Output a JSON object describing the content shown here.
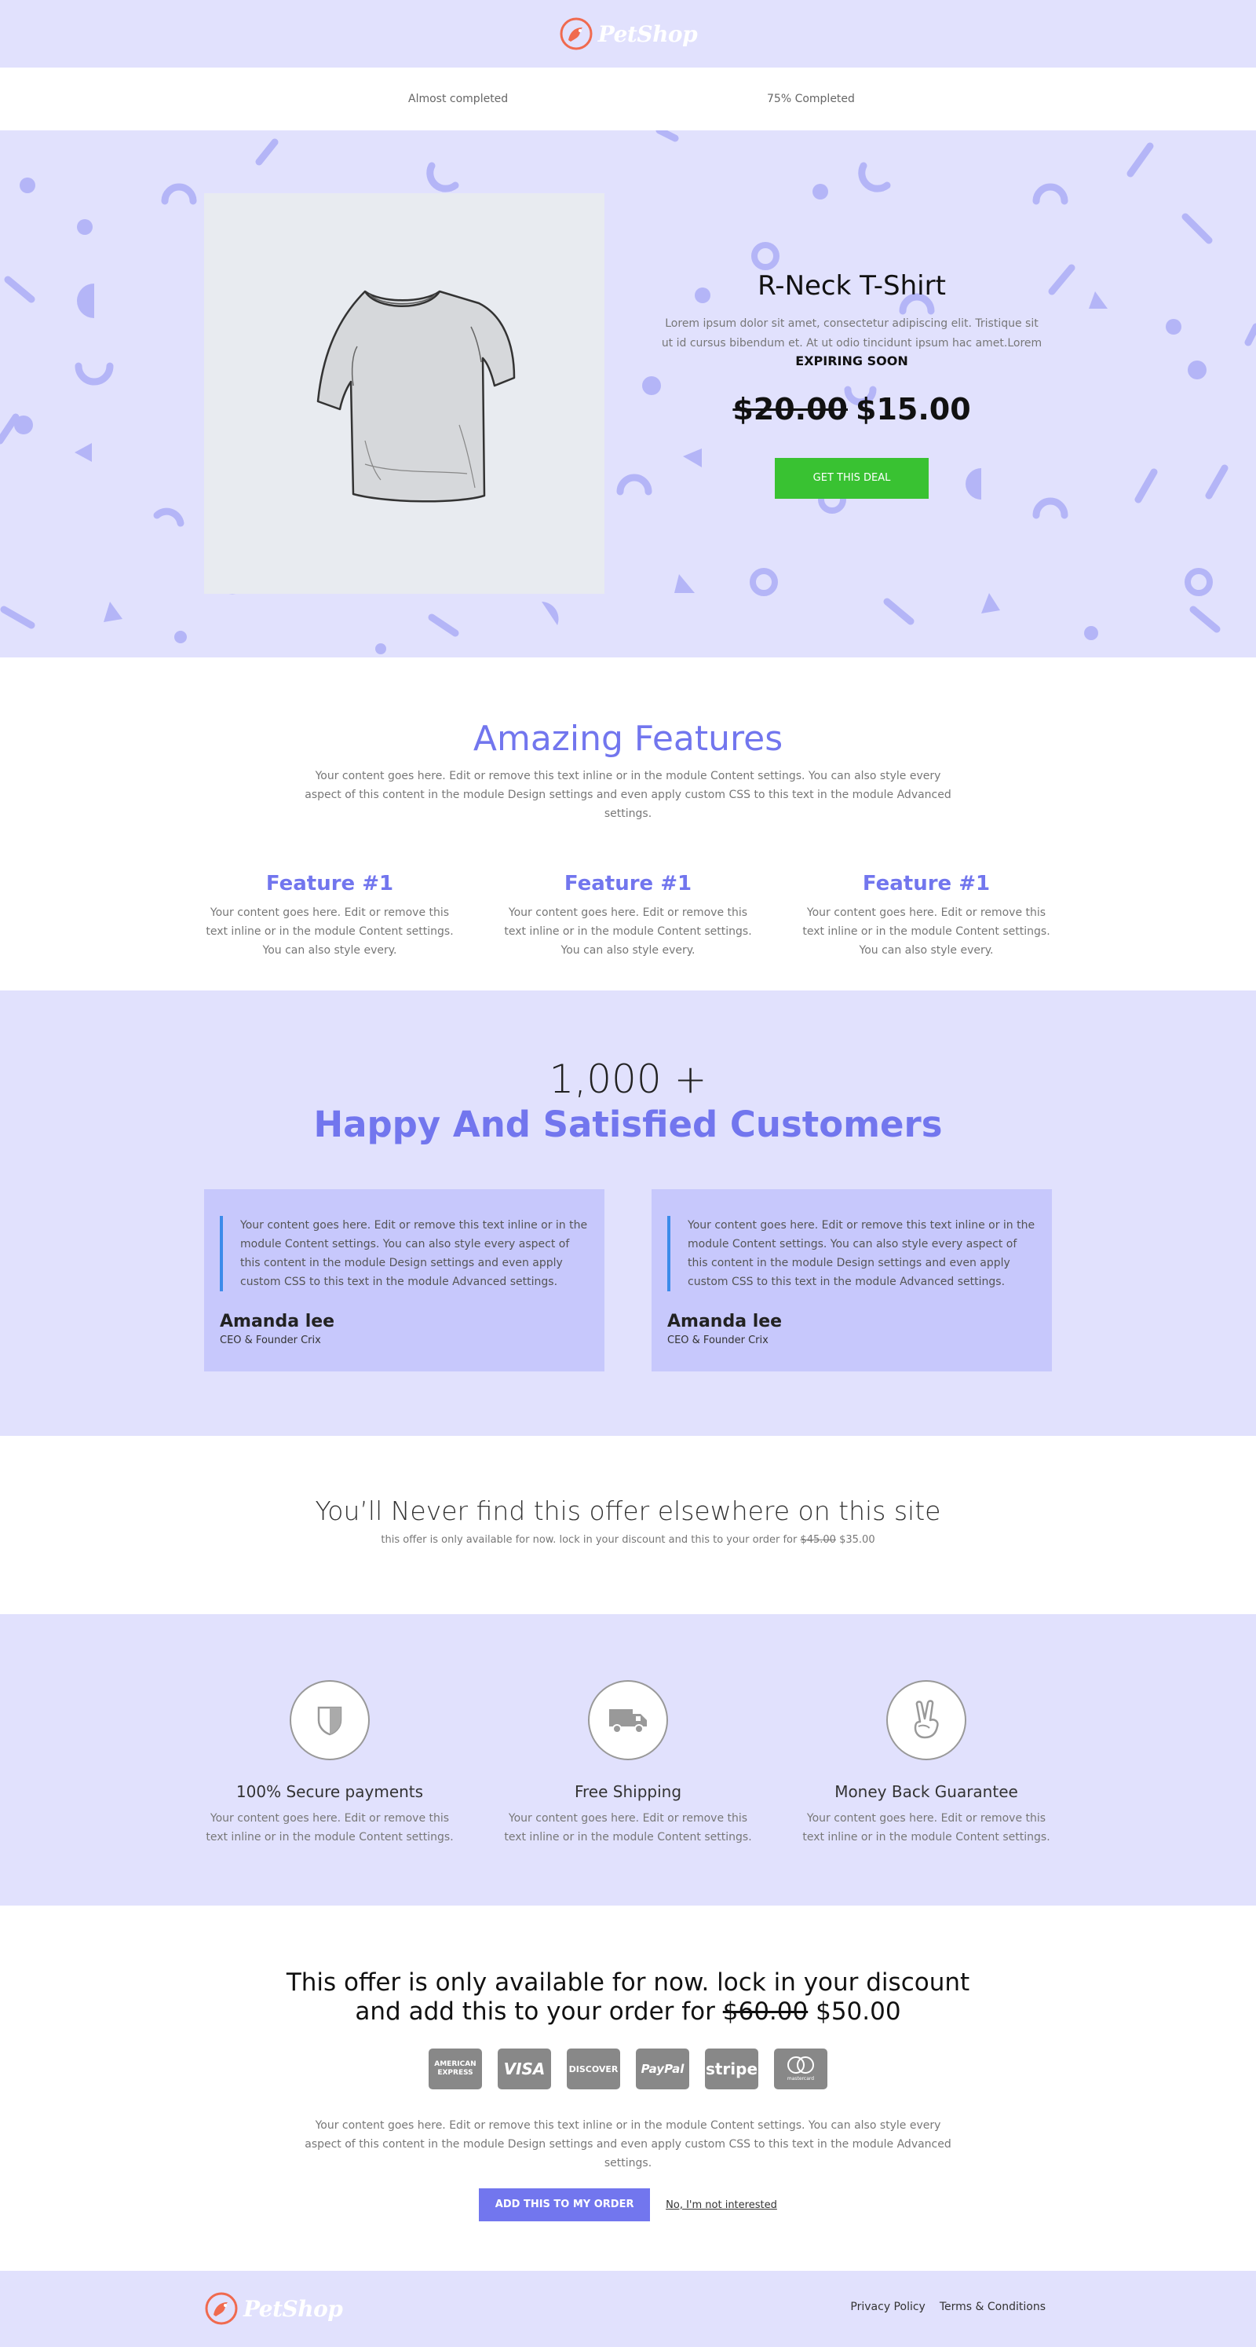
{
  "brand": {
    "name": "PetShop"
  },
  "progress": {
    "left_label": "Almost completed",
    "right_label": "75% Completed",
    "percent": 75
  },
  "hero": {
    "title": "R-Neck T-Shirt",
    "description": "Lorem ipsum dolor sit amet, consectetur adipiscing elit. Tristique sit ut id cursus bibendum et. At ut odio tincidunt ipsum hac amet.Lorem",
    "expiring": "EXPIRING SOON",
    "old_price": "$20.00",
    "new_price": "$15.00",
    "cta": "GET THIS DEAL"
  },
  "features": {
    "title": "Amazing Features",
    "subtitle": "Your content goes here. Edit or remove this text inline or in the module Content settings. You can also style every aspect of this content in the module Design settings and even apply custom CSS to this text in the module Advanced settings.",
    "items": [
      {
        "title": "Feature #1",
        "text": "Your content goes here. Edit or remove this text inline or in the module Content settings. You can also style every."
      },
      {
        "title": "Feature #1",
        "text": "Your content goes here. Edit or remove this text inline or in the module Content settings. You can also style every."
      },
      {
        "title": "Feature #1",
        "text": "Your content goes here. Edit or remove this text inline or in the module Content settings. You can also style every."
      }
    ]
  },
  "customers": {
    "count": "1,000 +",
    "title": "Happy And Satisfied Customers",
    "testimonials": [
      {
        "quote": "Your content goes here. Edit or remove this text inline or in the module Content settings. You can also style every aspect of this content in the module Design settings and even apply custom CSS to this text in the module Advanced settings.",
        "name": "Amanda lee",
        "role": "CEO & Founder Crix"
      },
      {
        "quote": "Your content goes here. Edit or remove this text inline or in the module Content settings. You can also style every aspect of this content in the module Design settings and even apply custom CSS to this text in the module Advanced settings.",
        "name": "Amanda lee",
        "role": "CEO & Founder Crix"
      }
    ]
  },
  "offer1": {
    "title": "You’ll Never find this offer elsewhere on this site",
    "text": "this offer is only available for now. lock in your discount and this to your order for",
    "old_price": "$45.00",
    "new_price": "$35.00"
  },
  "guarantees": [
    {
      "icon": "shield-icon",
      "title": "100% Secure payments",
      "text": "Your content goes here. Edit or remove this text inline or in the module Content settings."
    },
    {
      "icon": "truck-icon",
      "title": "Free Shipping",
      "text": "Your content goes here. Edit or remove this text inline or in the module Content settings."
    },
    {
      "icon": "peace-hand-icon",
      "title": "Money Back Guarantee",
      "text": "Your content goes here. Edit or remove this text inline or in the module Content settings."
    }
  ],
  "offer2": {
    "line1": "This offer is only available for now. lock in your discount",
    "line2": "and add this to your order for",
    "old_price": "$60.00",
    "new_price": "$50.00",
    "payments": [
      "AMERICAN EXPRESS",
      "VISA",
      "DISCOVER",
      "PayPal",
      "stripe",
      "mastercard"
    ],
    "subtitle": "Your content goes here. Edit or remove this text inline or in the module Content settings. You can also style every aspect of this content in the module Design settings and even apply custom CSS to this text in the module Advanced settings.",
    "add_button": "ADD THIS TO MY ORDER",
    "decline_link": "No, I'm not interested"
  },
  "footer": {
    "links": [
      "Privacy Policy",
      "Terms & Conditions"
    ]
  },
  "colors": {
    "lavender": "#e1e1fd",
    "accent": "#7276ee",
    "green": "#39c232",
    "card": "#c7c8fc",
    "quote_bar": "#3c8bea",
    "logo_orange": "#f06a4f"
  }
}
